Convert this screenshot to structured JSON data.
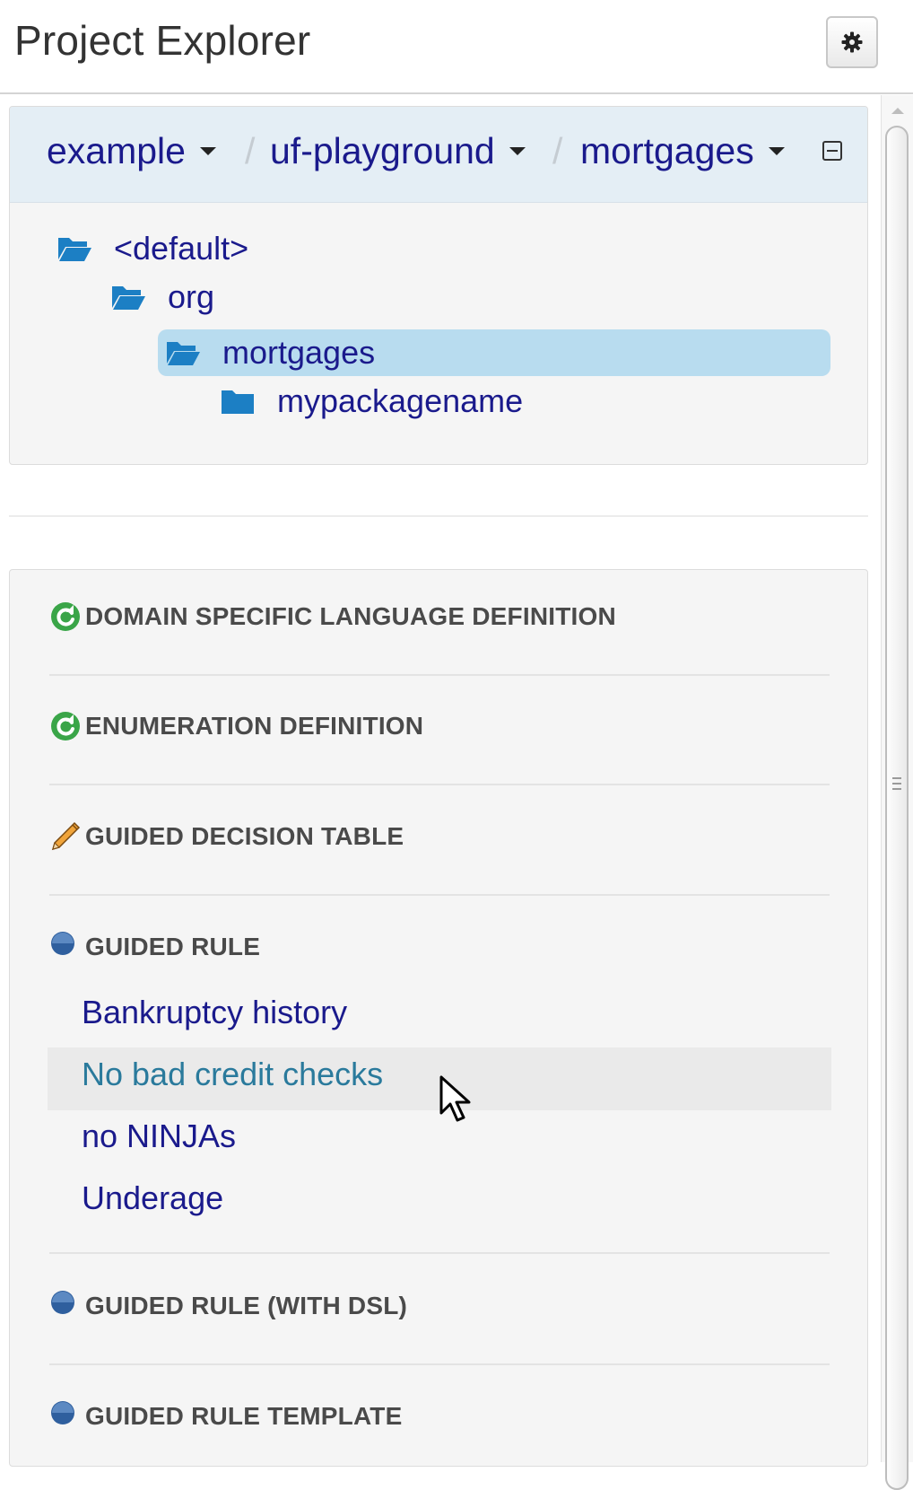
{
  "header": {
    "title": "Project Explorer",
    "settings_icon": "gear-icon"
  },
  "breadcrumb": {
    "items": [
      {
        "label": "example"
      },
      {
        "label": "uf-playground"
      },
      {
        "label": "mortgages"
      }
    ],
    "separator": "/",
    "collapse_icon": "collapse-icon"
  },
  "package_tree": {
    "items": [
      {
        "label": "<default>",
        "icon": "folder-open-icon",
        "selected": false
      },
      {
        "label": "org",
        "icon": "folder-open-icon",
        "selected": false
      },
      {
        "label": "mortgages",
        "icon": "folder-open-icon",
        "selected": true
      },
      {
        "label": "mypackagename",
        "icon": "folder-closed-icon",
        "selected": false
      }
    ],
    "selected_color": "#b8dcef"
  },
  "asset_groups": [
    {
      "title": "DOMAIN SPECIFIC LANGUAGE DEFINITION",
      "icon": "green-refresh-icon",
      "items": []
    },
    {
      "title": "ENUMERATION DEFINITION",
      "icon": "green-refresh-icon",
      "items": []
    },
    {
      "title": "GUIDED DECISION TABLE",
      "icon": "pencil-icon",
      "items": []
    },
    {
      "title": "GUIDED RULE",
      "icon": "blue-bullet-icon",
      "items": [
        "Bankruptcy history",
        "No bad credit checks",
        "no NINJAs",
        "Underage"
      ],
      "hovered": "No bad credit checks"
    },
    {
      "title": "GUIDED RULE (WITH DSL)",
      "icon": "blue-bullet-icon",
      "items": []
    },
    {
      "title": "GUIDED RULE TEMPLATE",
      "icon": "blue-bullet-icon",
      "items": []
    }
  ],
  "colors": {
    "link": "#1a1a8c",
    "hover_link": "#2a7a9c",
    "breadcrumb_bar": "#e4eef5",
    "panel_bg": "#f5f5f5"
  }
}
